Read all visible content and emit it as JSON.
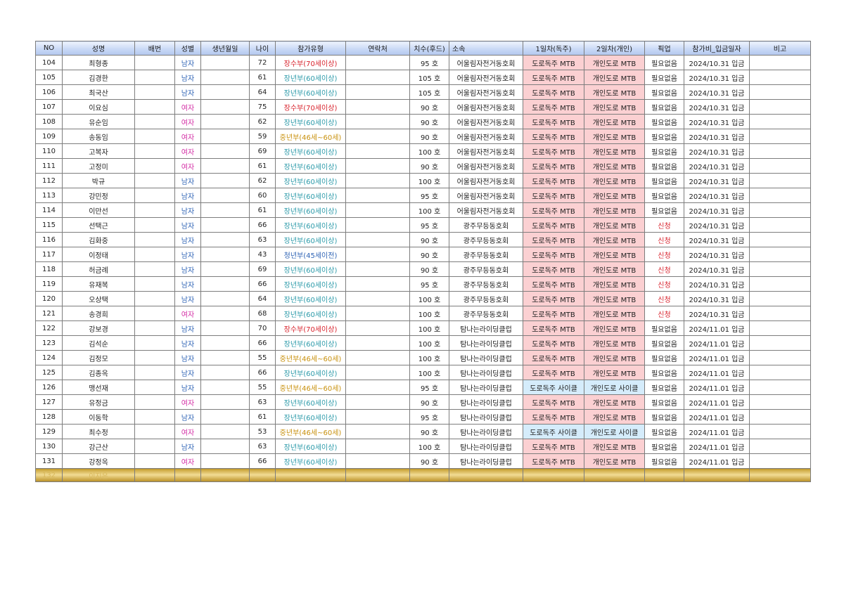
{
  "headers": {
    "no": "NO",
    "name": "성명",
    "bib": "배번",
    "gender": "성별",
    "birth": "생년월일",
    "age": "나이",
    "category": "참가유형",
    "contact": "연락처",
    "size": "치수(후드)",
    "affiliation": "소속",
    "day1": "1일차(독주)",
    "day2": "2일차(개인)",
    "pickup": "픽업",
    "paid": "참가비_입금일자",
    "note": "비고"
  },
  "colors": {
    "header_gradient_top": "#eef3fd",
    "header_gradient_bottom": "#b3c7ee",
    "male_text": "#2e63b5",
    "female_text": "#d42fa6",
    "category_senior_70": "#d8222c",
    "category_elder_60": "#2b9aa9",
    "category_middle": "#c8900c",
    "category_youth": "#2e63b5",
    "mtb_fill": "#fbd0d2",
    "cycle_fill": "#d5ecfb",
    "pickup_apply": "#d8222c",
    "gold_band": "#c7a033"
  },
  "rows": [
    {
      "no": "104",
      "name": "최형종",
      "gender": "남자",
      "gender_type": "male",
      "age": "72",
      "category": "장수부(70세이상)",
      "cat_type": "senior",
      "size": "95 호",
      "affiliation": "어울림자전거동호회",
      "day1": "도로독주 MTB",
      "day2": "개인도로 MTB",
      "bike": "mtb",
      "pickup": "필요없음",
      "pickup_type": "none",
      "paid": "2024/10.31 입금",
      "group_start": false
    },
    {
      "no": "105",
      "name": "김경한",
      "gender": "남자",
      "gender_type": "male",
      "age": "61",
      "category": "장년부(60세이상)",
      "cat_type": "elder",
      "size": "105 호",
      "affiliation": "어울림자전거동호회",
      "day1": "도로독주 MTB",
      "day2": "개인도로 MTB",
      "bike": "mtb",
      "pickup": "필요없음",
      "pickup_type": "none",
      "paid": "2024/10.31 입금",
      "group_start": false
    },
    {
      "no": "106",
      "name": "최국산",
      "gender": "남자",
      "gender_type": "male",
      "age": "64",
      "category": "장년부(60세이상)",
      "cat_type": "elder",
      "size": "105 호",
      "affiliation": "어울림자전거동호회",
      "day1": "도로독주 MTB",
      "day2": "개인도로 MTB",
      "bike": "mtb",
      "pickup": "필요없음",
      "pickup_type": "none",
      "paid": "2024/10.31 입금",
      "group_start": false
    },
    {
      "no": "107",
      "name": "이요심",
      "gender": "여자",
      "gender_type": "female",
      "age": "75",
      "category": "장수부(70세이상)",
      "cat_type": "senior",
      "size": "90 호",
      "affiliation": "어울림자전거동호회",
      "day1": "도로독주 MTB",
      "day2": "개인도로 MTB",
      "bike": "mtb",
      "pickup": "필요없음",
      "pickup_type": "none",
      "paid": "2024/10.31 입금",
      "group_start": false
    },
    {
      "no": "108",
      "name": "유순임",
      "gender": "여자",
      "gender_type": "female",
      "age": "62",
      "category": "장년부(60세이상)",
      "cat_type": "elder",
      "size": "90 호",
      "affiliation": "어울림자전거동호회",
      "day1": "도로독주 MTB",
      "day2": "개인도로 MTB",
      "bike": "mtb",
      "pickup": "필요없음",
      "pickup_type": "none",
      "paid": "2024/10.31 입금",
      "group_start": false
    },
    {
      "no": "109",
      "name": "송동임",
      "gender": "여자",
      "gender_type": "female",
      "age": "59",
      "category": "중년부(46세~60세)",
      "cat_type": "middle",
      "size": "90 호",
      "affiliation": "어울림자전거동호회",
      "day1": "도로독주 MTB",
      "day2": "개인도로 MTB",
      "bike": "mtb",
      "pickup": "필요없음",
      "pickup_type": "none",
      "paid": "2024/10.31 입금",
      "group_start": true
    },
    {
      "no": "110",
      "name": "고복자",
      "gender": "여자",
      "gender_type": "female",
      "age": "69",
      "category": "장년부(60세이상)",
      "cat_type": "elder",
      "size": "100 호",
      "affiliation": "어울림자전거동호회",
      "day1": "도로독주 MTB",
      "day2": "개인도로 MTB",
      "bike": "mtb",
      "pickup": "필요없음",
      "pickup_type": "none",
      "paid": "2024/10.31 입금",
      "group_start": false
    },
    {
      "no": "111",
      "name": "고정미",
      "gender": "여자",
      "gender_type": "female",
      "age": "61",
      "category": "장년부(60세이상)",
      "cat_type": "elder",
      "size": "90 호",
      "affiliation": "어울림자전거동호회",
      "day1": "도로독주 MTB",
      "day2": "개인도로 MTB",
      "bike": "mtb",
      "pickup": "필요없음",
      "pickup_type": "none",
      "paid": "2024/10.31 입금",
      "group_start": false
    },
    {
      "no": "112",
      "name": "박규",
      "gender": "남자",
      "gender_type": "male",
      "age": "62",
      "category": "장년부(60세이상)",
      "cat_type": "elder",
      "size": "100 호",
      "affiliation": "어울림자전거동호회",
      "day1": "도로독주 MTB",
      "day2": "개인도로 MTB",
      "bike": "mtb",
      "pickup": "필요없음",
      "pickup_type": "none",
      "paid": "2024/10.31 입금",
      "group_start": true
    },
    {
      "no": "113",
      "name": "강민정",
      "gender": "남자",
      "gender_type": "male",
      "age": "60",
      "category": "장년부(60세이상)",
      "cat_type": "elder",
      "size": "95 호",
      "affiliation": "어울림자전거동호회",
      "day1": "도로독주 MTB",
      "day2": "개인도로 MTB",
      "bike": "mtb",
      "pickup": "필요없음",
      "pickup_type": "none",
      "paid": "2024/10.31 입금",
      "group_start": false
    },
    {
      "no": "114",
      "name": "이만선",
      "gender": "남자",
      "gender_type": "male",
      "age": "61",
      "category": "장년부(60세이상)",
      "cat_type": "elder",
      "size": "100 호",
      "affiliation": "어울림자전거동호회",
      "day1": "도로독주 MTB",
      "day2": "개인도로 MTB",
      "bike": "mtb",
      "pickup": "필요없음",
      "pickup_type": "none",
      "paid": "2024/10.31 입금",
      "group_start": false
    },
    {
      "no": "115",
      "name": "선택근",
      "gender": "남자",
      "gender_type": "male",
      "age": "66",
      "category": "장년부(60세이상)",
      "cat_type": "elder",
      "size": "95 호",
      "affiliation": "광주무등동호회",
      "day1": "도로독주 MTB",
      "day2": "개인도로 MTB",
      "bike": "mtb",
      "pickup": "신청",
      "pickup_type": "apply",
      "paid": "2024/10.31 입금",
      "group_start": true
    },
    {
      "no": "116",
      "name": "김화중",
      "gender": "남자",
      "gender_type": "male",
      "age": "63",
      "category": "장년부(60세이상)",
      "cat_type": "elder",
      "size": "90 호",
      "affiliation": "광주무등동호회",
      "day1": "도로독주 MTB",
      "day2": "개인도로 MTB",
      "bike": "mtb",
      "pickup": "신청",
      "pickup_type": "apply",
      "paid": "2024/10.31 입금",
      "group_start": false
    },
    {
      "no": "117",
      "name": "이정태",
      "gender": "남자",
      "gender_type": "male",
      "age": "43",
      "category": "청년부(45세이전)",
      "cat_type": "youth",
      "size": "90 호",
      "affiliation": "광주무등동호회",
      "day1": "도로독주 MTB",
      "day2": "개인도로 MTB",
      "bike": "mtb",
      "pickup": "신청",
      "pickup_type": "apply",
      "paid": "2024/10.31 입금",
      "group_start": false
    },
    {
      "no": "118",
      "name": "허금례",
      "gender": "남자",
      "gender_type": "male",
      "age": "69",
      "category": "장년부(60세이상)",
      "cat_type": "elder",
      "size": "90 호",
      "affiliation": "광주무등동호회",
      "day1": "도로독주 MTB",
      "day2": "개인도로 MTB",
      "bike": "mtb",
      "pickup": "신청",
      "pickup_type": "apply",
      "paid": "2024/10.31 입금",
      "group_start": true
    },
    {
      "no": "119",
      "name": "유재복",
      "gender": "남자",
      "gender_type": "male",
      "age": "66",
      "category": "장년부(60세이상)",
      "cat_type": "elder",
      "size": "95 호",
      "affiliation": "광주무등동호회",
      "day1": "도로독주 MTB",
      "day2": "개인도로 MTB",
      "bike": "mtb",
      "pickup": "신청",
      "pickup_type": "apply",
      "paid": "2024/10.31 입금",
      "group_start": false
    },
    {
      "no": "120",
      "name": "오상택",
      "gender": "남자",
      "gender_type": "male",
      "age": "64",
      "category": "장년부(60세이상)",
      "cat_type": "elder",
      "size": "100 호",
      "affiliation": "광주무등동호회",
      "day1": "도로독주 MTB",
      "day2": "개인도로 MTB",
      "bike": "mtb",
      "pickup": "신청",
      "pickup_type": "apply",
      "paid": "2024/10.31 입금",
      "group_start": false
    },
    {
      "no": "121",
      "name": "송경희",
      "gender": "여자",
      "gender_type": "female",
      "age": "68",
      "category": "장년부(60세이상)",
      "cat_type": "elder",
      "size": "100 호",
      "affiliation": "광주무등동호회",
      "day1": "도로독주 MTB",
      "day2": "개인도로 MTB",
      "bike": "mtb",
      "pickup": "신청",
      "pickup_type": "apply",
      "paid": "2024/10.31 입금",
      "group_start": true
    },
    {
      "no": "122",
      "name": "강보경",
      "gender": "남자",
      "gender_type": "male",
      "age": "70",
      "category": "장수부(70세이상)",
      "cat_type": "senior",
      "size": "100 호",
      "affiliation": "탐나는라이딩클럽",
      "day1": "도로독주 MTB",
      "day2": "개인도로 MTB",
      "bike": "mtb",
      "pickup": "필요없음",
      "pickup_type": "none",
      "paid": "2024/11.01 입금",
      "group_start": false
    },
    {
      "no": "123",
      "name": "김석순",
      "gender": "남자",
      "gender_type": "male",
      "age": "66",
      "category": "장년부(60세이상)",
      "cat_type": "elder",
      "size": "100 호",
      "affiliation": "탐나는라이딩클럽",
      "day1": "도로독주 MTB",
      "day2": "개인도로 MTB",
      "bike": "mtb",
      "pickup": "필요없음",
      "pickup_type": "none",
      "paid": "2024/11.01 입금",
      "group_start": false
    },
    {
      "no": "124",
      "name": "김정모",
      "gender": "남자",
      "gender_type": "male",
      "age": "55",
      "category": "중년부(46세~60세)",
      "cat_type": "middle",
      "size": "100 호",
      "affiliation": "탐나는라이딩클럽",
      "day1": "도로독주 MTB",
      "day2": "개인도로 MTB",
      "bike": "mtb",
      "pickup": "필요없음",
      "pickup_type": "none",
      "paid": "2024/11.01 입금",
      "group_start": true
    },
    {
      "no": "125",
      "name": "김종옥",
      "gender": "남자",
      "gender_type": "male",
      "age": "66",
      "category": "장년부(60세이상)",
      "cat_type": "elder",
      "size": "100 호",
      "affiliation": "탐나는라이딩클럽",
      "day1": "도로독주 MTB",
      "day2": "개인도로 MTB",
      "bike": "mtb",
      "pickup": "필요없음",
      "pickup_type": "none",
      "paid": "2024/11.01 입금",
      "group_start": false
    },
    {
      "no": "126",
      "name": "맹선재",
      "gender": "남자",
      "gender_type": "male",
      "age": "55",
      "category": "중년부(46세~60세)",
      "cat_type": "middle",
      "size": "95 호",
      "affiliation": "탐나는라이딩클럽",
      "day1": "도로독주 사이클",
      "day2": "개인도로 사이클",
      "bike": "cycle",
      "pickup": "필요없음",
      "pickup_type": "none",
      "paid": "2024/11.01 입금",
      "group_start": true
    },
    {
      "no": "127",
      "name": "유정금",
      "gender": "여자",
      "gender_type": "female",
      "age": "63",
      "category": "장년부(60세이상)",
      "cat_type": "elder",
      "size": "90 호",
      "affiliation": "탐나는라이딩클럽",
      "day1": "도로독주 MTB",
      "day2": "개인도로 MTB",
      "bike": "mtb",
      "pickup": "필요없음",
      "pickup_type": "none",
      "paid": "2024/11.01 입금",
      "group_start": false
    },
    {
      "no": "128",
      "name": "이동학",
      "gender": "남자",
      "gender_type": "male",
      "age": "61",
      "category": "장년부(60세이상)",
      "cat_type": "elder",
      "size": "95 호",
      "affiliation": "탐나는라이딩클럽",
      "day1": "도로독주 MTB",
      "day2": "개인도로 MTB",
      "bike": "mtb",
      "pickup": "필요없음",
      "pickup_type": "none",
      "paid": "2024/11.01 입금",
      "group_start": false
    },
    {
      "no": "129",
      "name": "최수정",
      "gender": "여자",
      "gender_type": "female",
      "age": "53",
      "category": "중년부(46세~60세)",
      "cat_type": "middle",
      "size": "90 호",
      "affiliation": "탐나는라이딩클럽",
      "day1": "도로독주 사이클",
      "day2": "개인도로 사이클",
      "bike": "cycle",
      "pickup": "필요없음",
      "pickup_type": "none",
      "paid": "2024/11.01 입금",
      "group_start": false
    },
    {
      "no": "130",
      "name": "강근산",
      "gender": "남자",
      "gender_type": "male",
      "age": "63",
      "category": "장년부(60세이상)",
      "cat_type": "elder",
      "size": "100 호",
      "affiliation": "탐나는라이딩클럽",
      "day1": "도로독주 MTB",
      "day2": "개인도로 MTB",
      "bike": "mtb",
      "pickup": "필요없음",
      "pickup_type": "none",
      "paid": "2024/11.01 입금",
      "group_start": true
    },
    {
      "no": "131",
      "name": "강정옥",
      "gender": "여자",
      "gender_type": "female",
      "age": "66",
      "category": "장년부(60세이상)",
      "cat_type": "elder",
      "size": "90 호",
      "affiliation": "탐나는라이딩클럽",
      "day1": "도로독주 MTB",
      "day2": "개인도로 MTB",
      "bike": "mtb",
      "pickup": "필요없음",
      "pickup_type": "none",
      "paid": "2024/11.01 입금",
      "group_start": false
    }
  ],
  "gold_row": {
    "no": "132",
    "name": "이지은"
  }
}
